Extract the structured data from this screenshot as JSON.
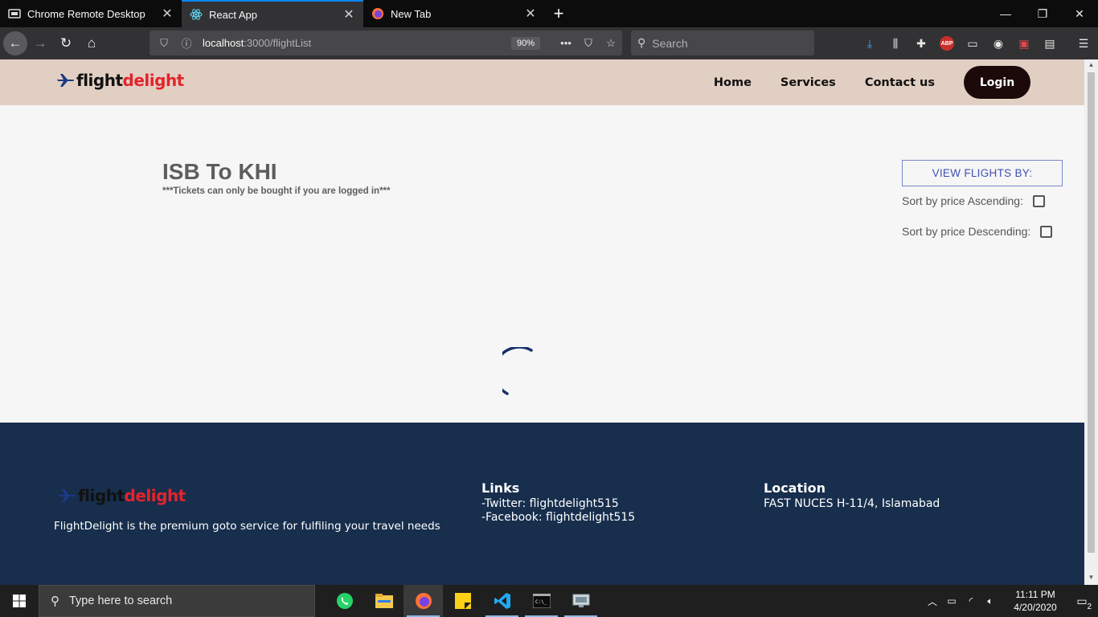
{
  "browser": {
    "tabs": [
      {
        "title": "Chrome Remote Desktop",
        "icon": "remote-desktop-icon",
        "active": false
      },
      {
        "title": "React App",
        "icon": "react-icon",
        "active": true
      },
      {
        "title": "New Tab",
        "icon": "firefox-icon",
        "active": false
      }
    ],
    "url_host": "localhost",
    "url_path": ":3000/flightList",
    "zoom": "90%",
    "search_placeholder": "Search",
    "abp_label": "ABP"
  },
  "site": {
    "logo_part1": "flight",
    "logo_part2": "delight",
    "nav": {
      "home": "Home",
      "services": "Services",
      "contact": "Contact us",
      "login": "Login"
    },
    "route_title": "ISB To KHI",
    "login_note": "***Tickets can only be bought if you are logged in***",
    "view_flights_by": "VIEW FLIGHTS BY:",
    "sort_asc": "Sort by price Ascending:",
    "sort_desc": "Sort by price Descending:",
    "sort_asc_checked": false,
    "sort_desc_checked": false
  },
  "footer": {
    "logo_part1": "flight",
    "logo_part2": "delight",
    "tagline": "FlightDelight is the premium goto service for fulfiling your travel needs",
    "links_heading": "Links",
    "links": [
      "-Twitter: flightdelight515",
      "-Facebook: flightdelight515"
    ],
    "location_heading": "Location",
    "location": "FAST NUCES H-11/4, Islamabad"
  },
  "taskbar": {
    "search_placeholder": "Type here to search",
    "time": "11:11 PM",
    "date": "4/20/2020",
    "notifications": "2"
  },
  "colors": {
    "header_bg": "#e2cfc3",
    "footer_bg": "#172e4d",
    "brand_red": "#e3242b",
    "accent_blue": "#3f51b5",
    "login_bg": "#1b0a09"
  }
}
